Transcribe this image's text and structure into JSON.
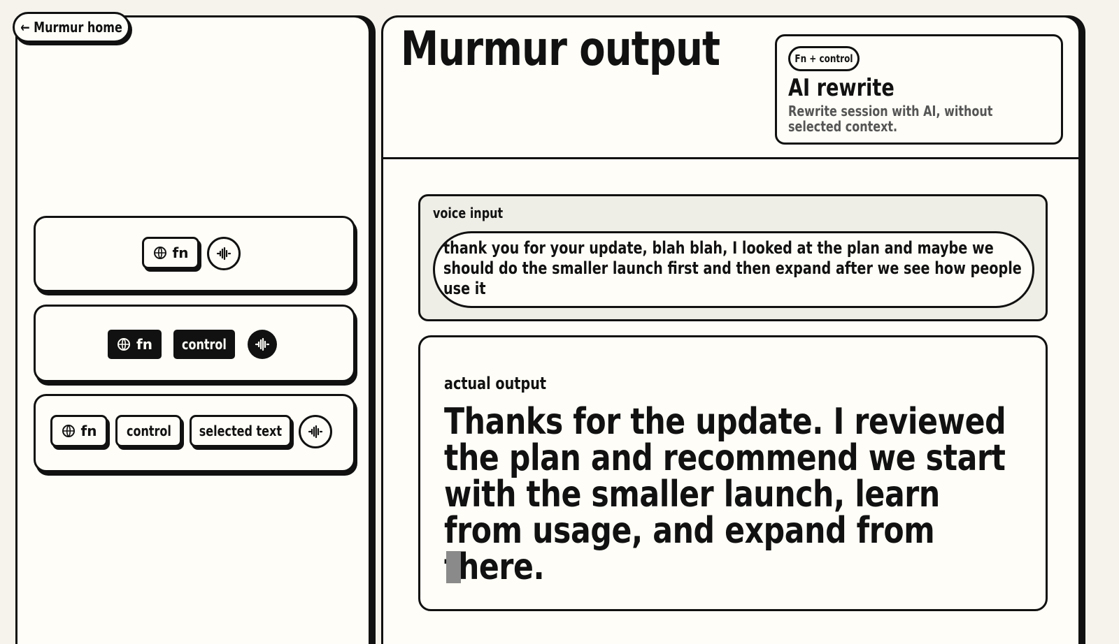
{
  "nav": {
    "home_label": "← Murmur home"
  },
  "shortcuts": {
    "card1": {
      "fn_label": "fn"
    },
    "card2": {
      "fn_label": "fn",
      "control_label": "control"
    },
    "card3": {
      "fn_label": "fn",
      "control_label": "control",
      "selected_label": "selected text"
    }
  },
  "main": {
    "title": "Murmur output",
    "rewrite": {
      "shortcut": "Fn + control",
      "title": "AI rewrite",
      "description": "Rewrite session with AI, without selected context."
    },
    "voice": {
      "label": "voice input",
      "text": "thank you for your update, blah blah, I looked at the plan and maybe we should do the smaller launch first and then expand after we see how people use it"
    },
    "output": {
      "label": "actual output",
      "text": "Thanks for the update. I reviewed the plan and recommend we start with the smaller launch, learn from usage, and expand from there."
    }
  },
  "icons": {
    "globe": "globe-icon",
    "waveform": "waveform-icon"
  },
  "colors": {
    "background": "#f5f3ec",
    "panel": "#fefdf7",
    "ink": "#111111",
    "voice_bg": "#eeede6",
    "cursor": "#8a8a8a"
  }
}
